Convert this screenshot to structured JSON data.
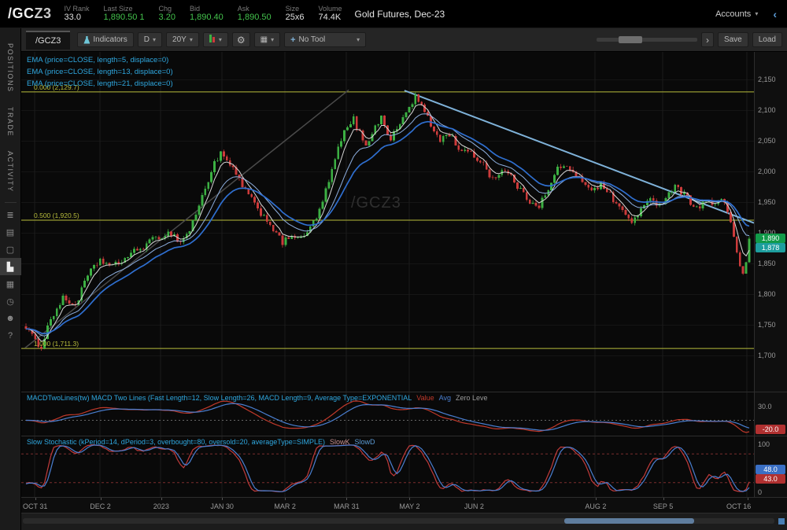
{
  "header": {
    "symbol_root": "/GC",
    "symbol_suffix": "Z3",
    "stats": [
      {
        "label": "IV Rank",
        "value": "33.0",
        "color": ""
      },
      {
        "label": "Last Size",
        "value": "1,890.50 1",
        "color": "green"
      },
      {
        "label": "Chg",
        "value": "3.20",
        "color": "green"
      },
      {
        "label": "Bid",
        "value": "1,890.40",
        "color": "green"
      },
      {
        "label": "Ask",
        "value": "1,890.50",
        "color": "green"
      },
      {
        "label": "Size",
        "value": "25x6",
        "color": ""
      },
      {
        "label": "Volume",
        "value": "74.4K",
        "color": ""
      }
    ],
    "description": "Gold Futures, Dec-23",
    "accounts_label": "Accounts"
  },
  "sidebar": {
    "tabs": [
      {
        "id": "positions",
        "label": "POSITIONS"
      },
      {
        "id": "trade",
        "label": "TRADE"
      },
      {
        "id": "activity",
        "label": "ACTIVITY"
      }
    ],
    "icons": [
      {
        "name": "quotes-icon",
        "glyph": "≣",
        "active": false
      },
      {
        "name": "watchlist-icon",
        "glyph": "▤",
        "active": false
      },
      {
        "name": "notes-icon",
        "glyph": "▢",
        "active": false
      },
      {
        "name": "chart-icon",
        "glyph": "▙",
        "active": true
      },
      {
        "name": "grid-icon",
        "glyph": "▦",
        "active": false
      },
      {
        "name": "clock-icon",
        "glyph": "◷",
        "active": false
      },
      {
        "name": "users-icon",
        "glyph": "☻",
        "active": false
      },
      {
        "name": "help-icon",
        "glyph": "?",
        "active": false
      }
    ]
  },
  "toolbar": {
    "tab": "/GCZ3",
    "indicators": "Indicators",
    "timeframe": "D",
    "range": "20Y",
    "tool": "No Tool",
    "save": "Save",
    "load": "Load"
  },
  "chart": {
    "watermark": "/GCZ3",
    "ema_labels": [
      "EMA (price=CLOSE, length=5, displace=0)",
      "EMA (price=CLOSE, length=13, displace=0)",
      "EMA (price=CLOSE, length=21, displace=0)"
    ],
    "fib_levels": [
      {
        "label": "0.000 (2,129.7)",
        "price": 2129.7
      },
      {
        "label": "0.500 (1,920.5)",
        "price": 1920.5
      },
      {
        "label": "1.000 (1,711.3)",
        "price": 1711.3
      }
    ],
    "price_axis": {
      "ticks": [
        {
          "t": "2,150",
          "v": 2150
        },
        {
          "t": "2,100",
          "v": 2100
        },
        {
          "t": "2,050",
          "v": 2050
        },
        {
          "t": "2,000",
          "v": 2000
        },
        {
          "t": "1,950",
          "v": 1950
        },
        {
          "t": "1,900",
          "v": 1900
        },
        {
          "t": "1,850",
          "v": 1850
        },
        {
          "t": "1,800",
          "v": 1800
        },
        {
          "t": "1,750",
          "v": 1750
        },
        {
          "t": "1,700",
          "v": 1700
        }
      ],
      "bubbles": [
        {
          "t": "1,890",
          "v": 1890.5,
          "bg": "#119a49"
        },
        {
          "t": "1,878",
          "v": 1876.0,
          "bg": "#1d9e9e"
        }
      ]
    }
  },
  "macd": {
    "label": "MACDTwoLines(tw) MACD Two Lines (Fast Length=12, Slow Length=26, MACD Length=9, Average Type=EXPONENTIAL",
    "legend": [
      {
        "t": "Value",
        "c": "#c0392b"
      },
      {
        "t": "Avg",
        "c": "#4a7fd1"
      },
      {
        "t": "Zero Leve",
        "c": "#9a9a9a"
      }
    ],
    "axis_labels": [
      {
        "t": "30.0",
        "v": 30
      }
    ],
    "bubbles": [
      {
        "t": "-20.0",
        "v": -20,
        "bg": "#b03030"
      }
    ]
  },
  "stoch": {
    "label": "Slow Stochastic (kPeriod=14, dPeriod=3, overbought=80, oversold=20, averageType=SIMPLE)",
    "legend": [
      {
        "t": "SlowK",
        "c": "#c89090"
      },
      {
        "t": "SlowD",
        "c": "#5b9bd5"
      }
    ],
    "axis_labels": [
      {
        "t": "100",
        "v": 100
      },
      {
        "t": "0",
        "v": 0
      }
    ],
    "bubbles": [
      {
        "t": "48.0",
        "v": 48,
        "bg": "#3a6fc4"
      },
      {
        "t": "43.0",
        "v": 43,
        "bg": "#b03030"
      }
    ]
  },
  "colors": {
    "up": "#3cb043",
    "down": "#cc3b3b",
    "ema5": "#d8d8d8",
    "ema13": "#8fb0e0",
    "ema21": "#2f6fd0",
    "macd_value": "#c0392b",
    "macd_avg": "#4a7fd1",
    "stoch_k": "#c23b3b",
    "stoch_d": "#4a7fd1",
    "fib": "#b9bd3c",
    "grid_h": "#151515",
    "grid_v": "#1a1a1a",
    "trend_dark": "#4a4a4a",
    "trend_blue": "#7fb2d9",
    "overbought_oversold": "#7a2d2d",
    "zero_line": "#666666"
  },
  "chart_data": {
    "type": "candlestick",
    "symbol": "/GCZ3",
    "title": "Gold Futures, Dec-23",
    "aggregation": "D",
    "range": "20Y",
    "p_min": 1641,
    "p_max": 2195,
    "num_candles": 235,
    "last_close": 1890.5,
    "swing_high": 2129.7,
    "swing_high_idx": 126,
    "swing_low": 1711.3,
    "swing_low_idx": 4,
    "noise_amp": 5.5,
    "wick_amp": 5,
    "seed": 1234,
    "price_keypoints": [
      [
        0,
        1748
      ],
      [
        3,
        1722
      ],
      [
        5,
        1716
      ],
      [
        8,
        1760
      ],
      [
        12,
        1792
      ],
      [
        16,
        1782
      ],
      [
        20,
        1830
      ],
      [
        24,
        1856
      ],
      [
        28,
        1844
      ],
      [
        33,
        1862
      ],
      [
        38,
        1878
      ],
      [
        43,
        1894
      ],
      [
        47,
        1900
      ],
      [
        50,
        1884
      ],
      [
        53,
        1905
      ],
      [
        57,
        1958
      ],
      [
        61,
        2015
      ],
      [
        63,
        2028
      ],
      [
        66,
        2010
      ],
      [
        70,
        1978
      ],
      [
        74,
        1945
      ],
      [
        79,
        1915
      ],
      [
        83,
        1882
      ],
      [
        86,
        1898
      ],
      [
        89,
        1888
      ],
      [
        92,
        1908
      ],
      [
        95,
        1935
      ],
      [
        99,
        2000
      ],
      [
        102,
        2055
      ],
      [
        106,
        2085
      ],
      [
        108,
        2062
      ],
      [
        110,
        2045
      ],
      [
        113,
        2072
      ],
      [
        115,
        2088
      ],
      [
        118,
        2052
      ],
      [
        121,
        2078
      ],
      [
        124,
        2105
      ],
      [
        126,
        2122
      ],
      [
        128,
        2108
      ],
      [
        131,
        2075
      ],
      [
        134,
        2052
      ],
      [
        137,
        2062
      ],
      [
        140,
        2038
      ],
      [
        143,
        2030
      ],
      [
        146,
        2022
      ],
      [
        148,
        2012
      ],
      [
        151,
        1988
      ],
      [
        154,
        2002
      ],
      [
        157,
        1992
      ],
      [
        160,
        1968
      ],
      [
        163,
        1952
      ],
      [
        166,
        1946
      ],
      [
        169,
        1968
      ],
      [
        172,
        2005
      ],
      [
        174,
        2012
      ],
      [
        177,
        1995
      ],
      [
        180,
        1985
      ],
      [
        183,
        1972
      ],
      [
        186,
        1978
      ],
      [
        188,
        1968
      ],
      [
        191,
        1948
      ],
      [
        194,
        1928
      ],
      [
        196,
        1918
      ],
      [
        199,
        1938
      ],
      [
        202,
        1952
      ],
      [
        205,
        1948
      ],
      [
        208,
        1962
      ],
      [
        210,
        1980
      ],
      [
        212,
        1968
      ],
      [
        215,
        1950
      ],
      [
        218,
        1942
      ],
      [
        220,
        1952
      ],
      [
        223,
        1946
      ],
      [
        226,
        1952
      ],
      [
        228,
        1918
      ],
      [
        230,
        1868
      ],
      [
        232,
        1830
      ],
      [
        233,
        1852
      ],
      [
        234,
        1890.5
      ]
    ],
    "trendlines": [
      {
        "name": "ascending-trendline",
        "x1f": 0.005,
        "p1": 1712,
        "x2f": 0.447,
        "p2": 2133,
        "color": "#4a4a4a",
        "width": 1.5
      },
      {
        "name": "descending-trendline",
        "x1f": 0.523,
        "p1": 2132,
        "x2f": 1.0,
        "p2": 1916,
        "color": "#7fb2d9",
        "width": 2
      }
    ],
    "emas": [
      5,
      13,
      21
    ],
    "macd_params": {
      "fast": 12,
      "slow": 26,
      "signal": 9
    },
    "stoch_params": {
      "k": 14,
      "smooth": 3,
      "overbought": 80,
      "oversold": 20
    },
    "x_labels": [
      {
        "t": "OCT 31",
        "f": 0.019
      },
      {
        "t": "DEC 2",
        "f": 0.108
      },
      {
        "t": "2023",
        "f": 0.191
      },
      {
        "t": "JAN 30",
        "f": 0.274
      },
      {
        "t": "MAR 2",
        "f": 0.36
      },
      {
        "t": "MAR 31",
        "f": 0.444
      },
      {
        "t": "MAY 2",
        "f": 0.53
      },
      {
        "t": "JUN 2",
        "f": 0.618
      },
      {
        "t": "AUG 2",
        "f": 0.784
      },
      {
        "t": "SEP 5",
        "f": 0.876
      },
      {
        "t": "OCT 16",
        "f": 0.991
      }
    ]
  }
}
